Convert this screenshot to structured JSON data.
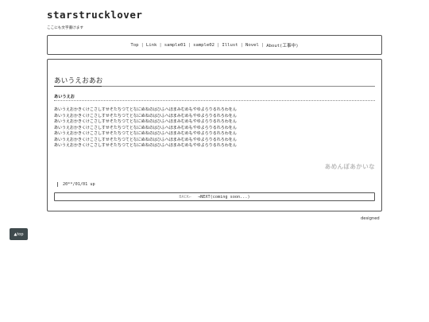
{
  "site": {
    "title": "starstrucklover",
    "description": "ここにも文字書けます"
  },
  "nav": {
    "items": [
      "Top",
      "Link",
      "sample01",
      "sample02",
      "Illust",
      "Novel",
      "About(工事中)"
    ]
  },
  "main": {
    "heading": "あいうえおあお",
    "subheading": "あいうえお",
    "lines": [
      "あいうえおかきくけこさしすせそたちつてとなにぬねのはひふへほまみむめもやゆよらりるれろわをん",
      "あいうえおかきくけこさしすせそたちつてとなにぬねのはひふへほまみむめもやゆよらりるれろわをん",
      "あいうえおかきくけこさしすせそたちつてとなにぬねのはひふへほまみむめもやゆよらりるれろわをん",
      "あいうえおかきくけこさしすせそたちつてとなにぬねのはひふへほまみむめもやゆよらりるれろわをん",
      "あいうえおかきくけこさしすせそたちつてとなにぬねのはひふへほまみむめもやゆよらりるれろわをん",
      "あいうえおかきくけこさしすせそたちつてとなにぬねのはひふへほまみむめもやゆよらりるれろわをん",
      "あいうえおかきくけこさしすせそたちつてとなにぬねのはひふへほまみむめもやゆよらりるれろわをん"
    ],
    "signature": "あめんぼあかいな",
    "date": "20**/01/01 up"
  },
  "pager": {
    "back": "BACK←",
    "next": "→NEXT(coming soon...)"
  },
  "footer": {
    "designed": "designed",
    "top_button": "▲top"
  }
}
